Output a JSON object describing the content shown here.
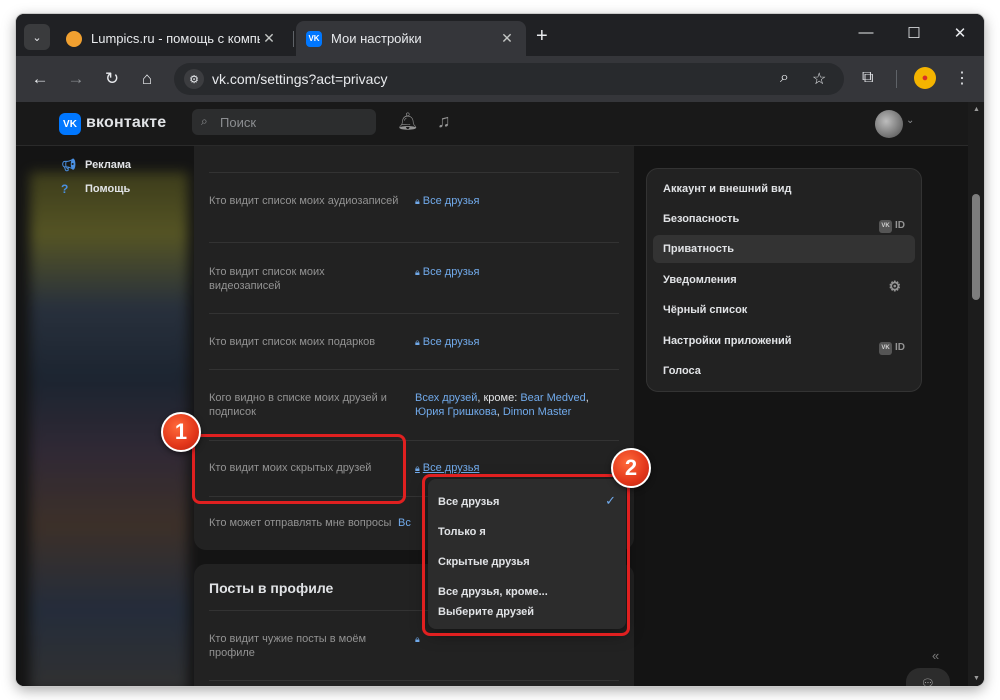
{
  "browser": {
    "tabs": [
      {
        "title": "Lumpics.ru - помощь с компью",
        "active": false,
        "favicon": "orange-circle-icon"
      },
      {
        "title": "Мои настройки",
        "active": true,
        "favicon": "vk-icon"
      }
    ],
    "new_tab_symbol": "+",
    "url": "vk.com/settings?act=privacy"
  },
  "vk": {
    "brand": "вконтакте",
    "search_placeholder": "Поиск",
    "left_nav": [
      {
        "label": "Реклама",
        "icon": "megaphone-icon"
      },
      {
        "label": "Помощь",
        "icon": "help-circle-icon"
      }
    ]
  },
  "settings_rows": [
    {
      "label": "Кто видит список моих аудиозаписей",
      "value": "Все друзья"
    },
    {
      "label": "Кто видит список моих видеозаписей",
      "value": "Все друзья"
    },
    {
      "label": "Кто видит список моих подарков",
      "value": "Все друзья"
    },
    {
      "label": "Кого видно в списке моих друзей и подписок",
      "value_parts": [
        "Всех друзей",
        ", кроме: ",
        "Bear Medved",
        ",",
        "Юрия Гришкова",
        ", ",
        "Dimon Master"
      ]
    },
    {
      "label": "Кто видит моих скрытых друзей",
      "value": "Все друзья"
    },
    {
      "label": "Кто может отправлять мне вопросы",
      "value": "Вс"
    }
  ],
  "posts_section": {
    "title": "Посты в профиле",
    "rows": [
      {
        "label": "Кто видит чужие посты в моём профиле"
      }
    ]
  },
  "right_menu": [
    {
      "label": "Аккаунт и внешний вид"
    },
    {
      "label": "Безопасность",
      "badge": "ID"
    },
    {
      "label": "Приватность",
      "active": true
    },
    {
      "label": "Уведомления",
      "icon": "gear-icon"
    },
    {
      "label": "Чёрный список"
    },
    {
      "label": "Настройки приложений",
      "badge": "ID"
    },
    {
      "label": "Голоса"
    }
  ],
  "dropdown": {
    "options": [
      "Все друзья",
      "Только я",
      "Скрытые друзья",
      "Все друзья, кроме...",
      "Выберите друзей"
    ],
    "selected": "Все друзья"
  },
  "annotations": {
    "marker_1": "1",
    "marker_2": "2",
    "color": "#e02020"
  },
  "colors": {
    "vk_blue": "#0077ff",
    "link": "#71aaeb",
    "background": "#141414",
    "card": "#222222"
  }
}
